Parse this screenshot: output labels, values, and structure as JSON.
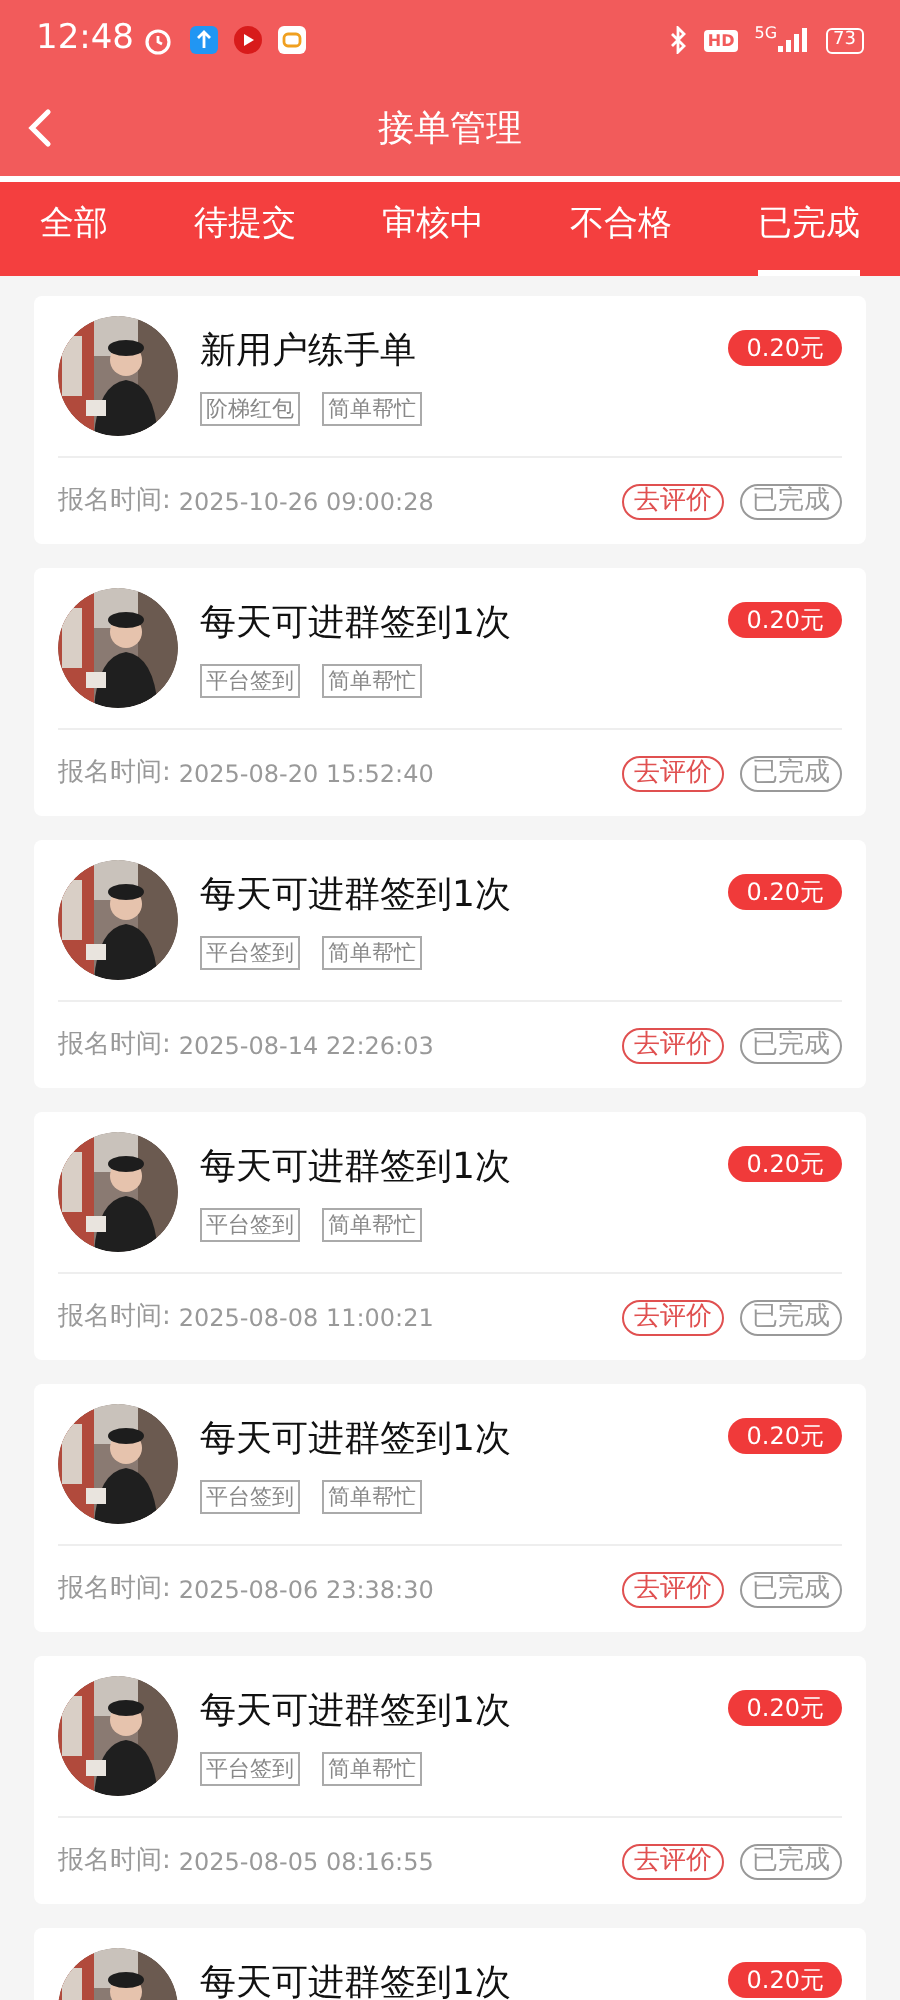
{
  "status_bar": {
    "time": "12:48",
    "hd": "HD",
    "network": "5G",
    "battery": "73"
  },
  "header": {
    "title": "接单管理"
  },
  "tabs": [
    {
      "label": "全部",
      "selected": false
    },
    {
      "label": "待提交",
      "selected": false
    },
    {
      "label": "审核中",
      "selected": false
    },
    {
      "label": "不合格",
      "selected": false
    },
    {
      "label": "已完成",
      "selected": true
    }
  ],
  "orders": [
    {
      "title": "新用户练手单",
      "price": "0.20元",
      "tags": [
        "阶梯红包",
        "简单帮忙"
      ],
      "time_label": "报名时间:",
      "time": "2025-10-26 09:00:28",
      "action": "去评价",
      "status": "已完成"
    },
    {
      "title": "每天可进群签到1次",
      "price": "0.20元",
      "tags": [
        "平台签到",
        "简单帮忙"
      ],
      "time_label": "报名时间:",
      "time": "2025-08-20 15:52:40",
      "action": "去评价",
      "status": "已完成"
    },
    {
      "title": "每天可进群签到1次",
      "price": "0.20元",
      "tags": [
        "平台签到",
        "简单帮忙"
      ],
      "time_label": "报名时间:",
      "time": "2025-08-14 22:26:03",
      "action": "去评价",
      "status": "已完成"
    },
    {
      "title": "每天可进群签到1次",
      "price": "0.20元",
      "tags": [
        "平台签到",
        "简单帮忙"
      ],
      "time_label": "报名时间:",
      "time": "2025-08-08 11:00:21",
      "action": "去评价",
      "status": "已完成"
    },
    {
      "title": "每天可进群签到1次",
      "price": "0.20元",
      "tags": [
        "平台签到",
        "简单帮忙"
      ],
      "time_label": "报名时间:",
      "time": "2025-08-06 23:38:30",
      "action": "去评价",
      "status": "已完成"
    },
    {
      "title": "每天可进群签到1次",
      "price": "0.20元",
      "tags": [
        "平台签到",
        "简单帮忙"
      ],
      "time_label": "报名时间:",
      "time": "2025-08-05 08:16:55",
      "action": "去评价",
      "status": "已完成"
    },
    {
      "title": "每天可进群签到1次",
      "price": "0.20元"
    }
  ]
}
